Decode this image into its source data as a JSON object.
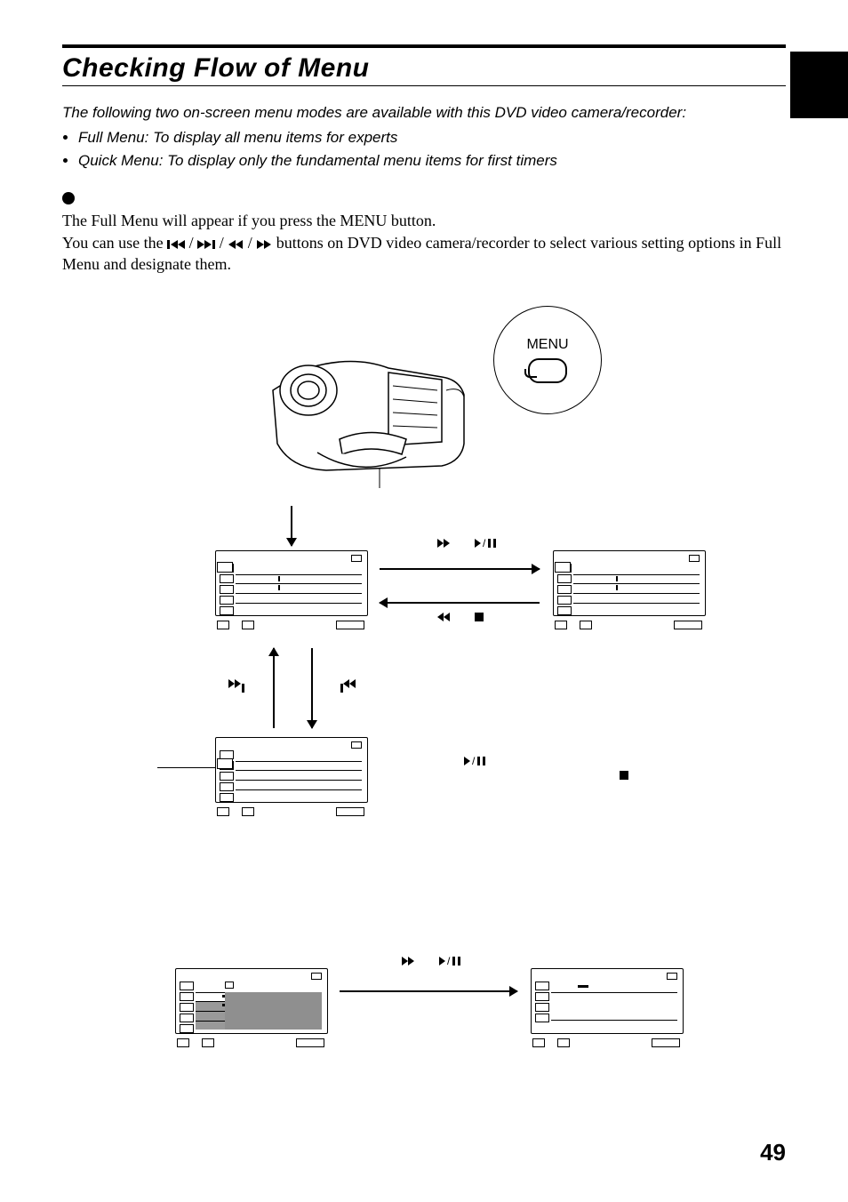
{
  "page": {
    "title": "Checking Flow of Menu",
    "intro_lead": "The following two on-screen menu modes are available with this DVD video camera/recorder:",
    "intro_items": [
      "Full Menu: To display all menu items for experts",
      "Quick Menu: To display only the fundamental menu items for first timers"
    ],
    "body_line1": "The Full Menu will appear if you press the MENU button.",
    "body_line2a": "You can use the ",
    "body_line2b": " buttons on DVD video camera/recorder to select various setting options in Full Menu and designate them.",
    "menu_label": "MENU",
    "page_number": "49"
  },
  "icons": {
    "prev_track": "prev-track",
    "next_track": "next-track",
    "rewind": "rewind",
    "fast_forward": "fast-forward",
    "play_pause": "play-pause",
    "stop": "stop"
  }
}
